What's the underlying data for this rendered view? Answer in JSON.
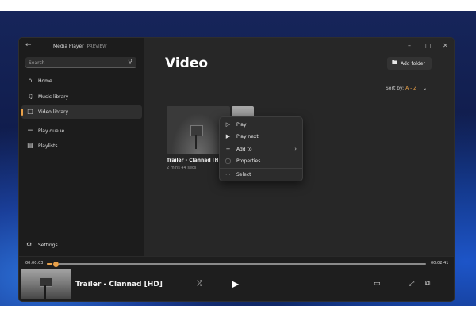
{
  "app": {
    "title": "Media Player",
    "badge": "PREVIEW",
    "back_icon": "back-arrow-icon",
    "window_controls": [
      "minimize-icon",
      "maximize-icon",
      "close-icon"
    ]
  },
  "search": {
    "placeholder": "Search"
  },
  "sidebar": {
    "items": [
      {
        "label": "Home",
        "icon": "home-icon",
        "active": false
      },
      {
        "label": "Music library",
        "icon": "music-note-icon",
        "active": false
      },
      {
        "label": "Video library",
        "icon": "video-icon",
        "active": true
      },
      {
        "label": "Play queue",
        "icon": "queue-icon",
        "active": false
      },
      {
        "label": "Playlists",
        "icon": "playlist-icon",
        "active": false
      }
    ],
    "settings_label": "Settings"
  },
  "main": {
    "title": "Video",
    "add_folder_label": "Add folder",
    "sort_label": "Sort by:",
    "sort_value": "A - Z",
    "tile": {
      "title": "Trailer - Clannad [HD]",
      "duration": "2 mins 44 secs"
    }
  },
  "context_menu": {
    "items": [
      {
        "label": "Play",
        "icon": "play-icon"
      },
      {
        "label": "Play next",
        "icon": "play-next-icon"
      },
      {
        "label": "Add to",
        "icon": "add-icon",
        "submenu": true
      },
      {
        "label": "Properties",
        "icon": "info-icon"
      },
      {
        "label": "Select",
        "icon": "select-icon"
      }
    ]
  },
  "player": {
    "elapsed": "00:00:03",
    "total": "00:02:41",
    "progress": 0.02,
    "now_playing_title": "Trailer - Clannad [HD]"
  },
  "colors": {
    "accent": "#e9a14a",
    "window_bg": "#202020",
    "sidebar_bg": "#1c1c1c",
    "main_bg": "#272727"
  }
}
